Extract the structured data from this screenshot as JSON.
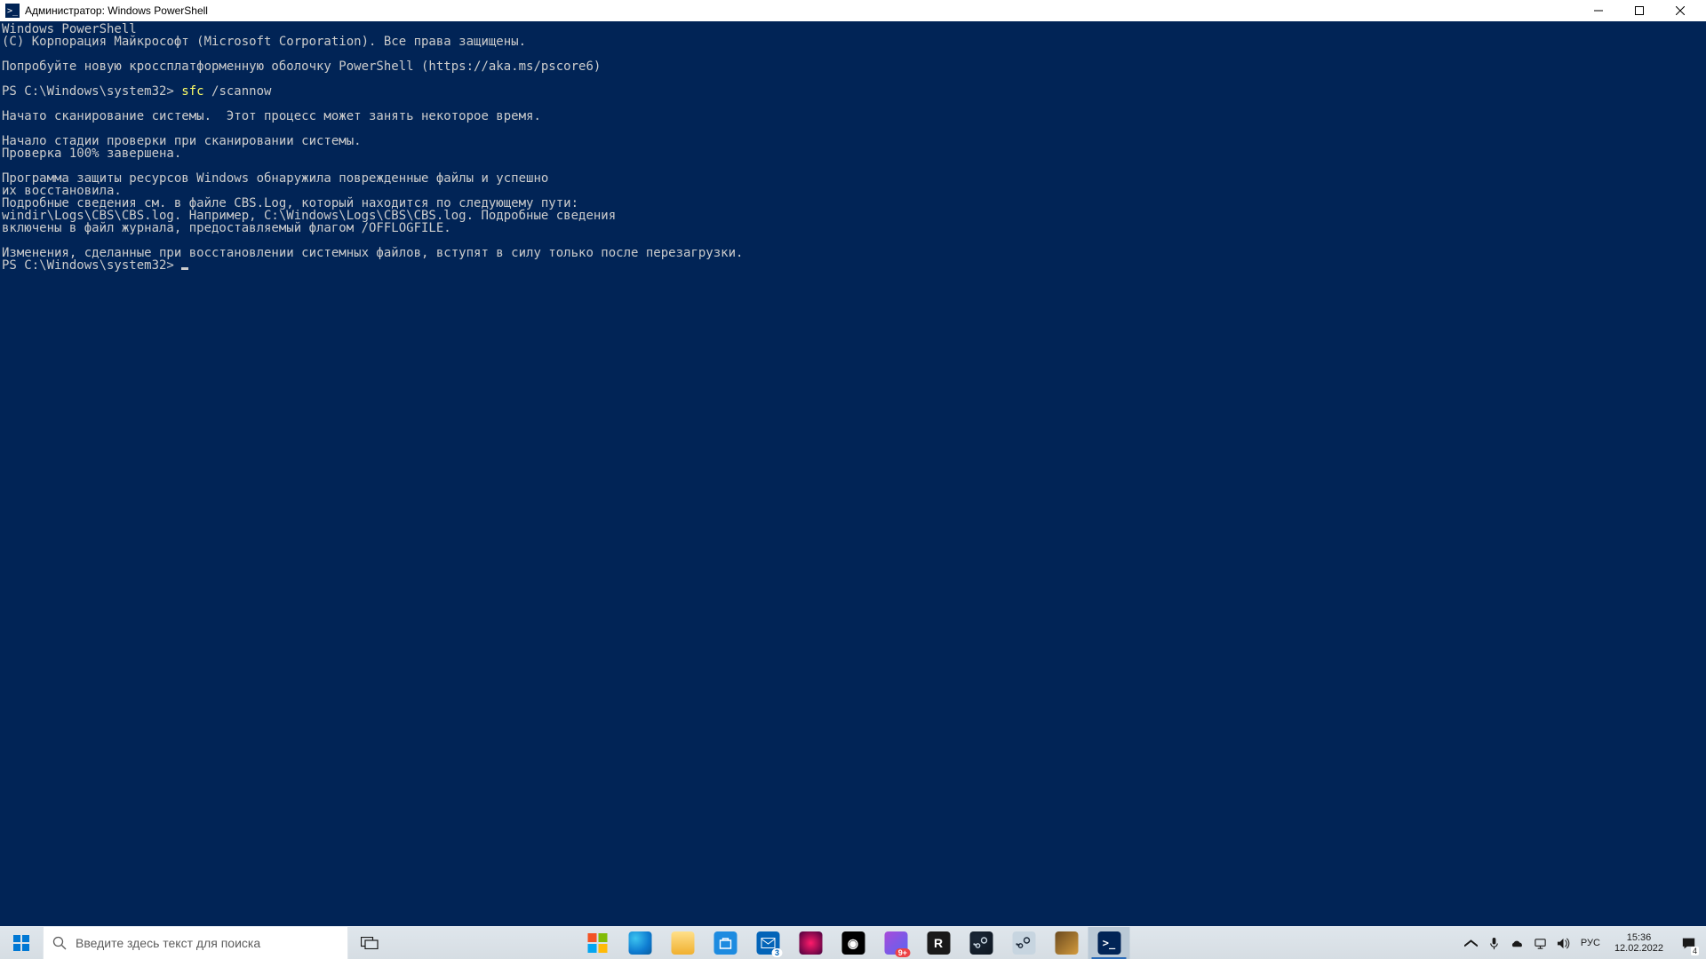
{
  "titlebar": {
    "icon_text": ">_",
    "title": "Администратор: Windows PowerShell"
  },
  "console": {
    "lines": [
      "Windows PowerShell",
      "(C) Корпорация Майкрософт (Microsoft Corporation). Все права защищены.",
      "",
      "Попробуйте новую кроссплатформенную оболочку PowerShell (https://aka.ms/pscore6)",
      ""
    ],
    "prompt1_prefix": "PS C:\\Windows\\system32> ",
    "prompt1_cmd": "sfc",
    "prompt1_arg": " /scannow",
    "lines2": [
      "",
      "Начато сканирование системы.  Этот процесс может занять некоторое время.",
      "",
      "Начало стадии проверки при сканировании системы.",
      "Проверка 100% завершена.",
      "",
      "Программа защиты ресурсов Windows обнаружила поврежденные файлы и успешно",
      "их восстановила.",
      "Подробные сведения см. в файле CBS.Log, который находится по следующему пути:",
      "windir\\Logs\\CBS\\CBS.log. Например, C:\\Windows\\Logs\\CBS\\CBS.log. Подробные сведения",
      "включены в файл журнала, предоставляемый флагом /OFFLOGFILE.",
      "",
      "Изменения, сделанные при восстановлении системных файлов, вступят в силу только после перезагрузки."
    ],
    "prompt2": "PS C:\\Windows\\system32> "
  },
  "taskbar": {
    "search_placeholder": "Введите здесь текст для поиска",
    "mail_badge": "3",
    "discord_badge": "9+",
    "lang": "РУС",
    "time": "15:36",
    "date": "12.02.2022",
    "notif_count": "4",
    "nvidia_glyph": "◉",
    "r_glyph": "R",
    "ps_glyph": ">_"
  }
}
